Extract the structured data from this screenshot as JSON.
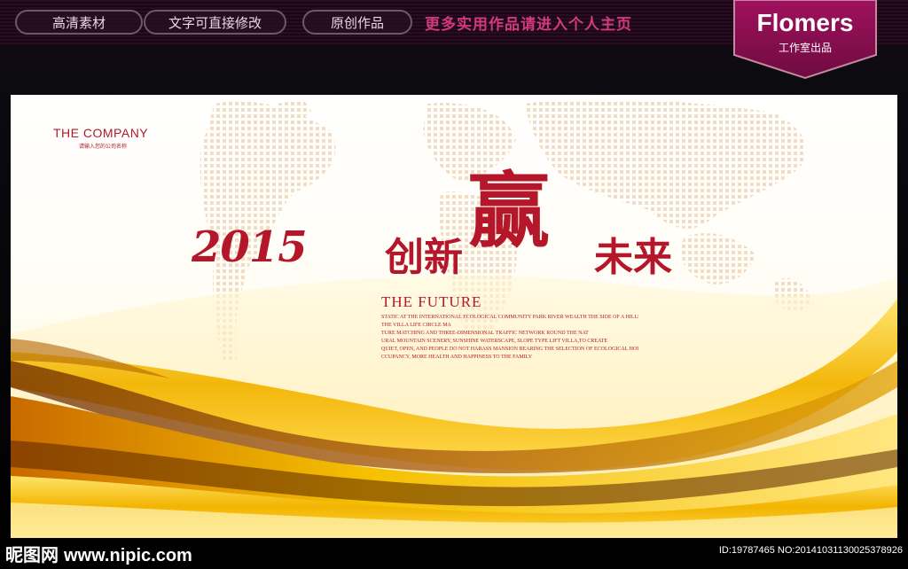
{
  "header": {
    "pills": [
      "高清素材",
      "文字可直接修改",
      "原创作品"
    ],
    "promo": "更多实用作品请进入个人主页",
    "brand": {
      "name": "Flomers",
      "sub": "工作室出品"
    }
  },
  "poster": {
    "company": "THE COMPANY",
    "company_sub": "请输入您的公司名称",
    "headline": {
      "year": "2015",
      "part_a": "创新",
      "win": "赢",
      "part_b": "未来"
    },
    "future_title": "THE FUTURE",
    "description": [
      "STATIC AT THE INTERNATIONAL ECOLOGICAL COMMUNITY PARK RIVER WEALTH THE SIDE OF A HILLENJOY",
      "THE VILLA LIFE CIRCLE MA",
      "TURE MATCHING AND THREE-DIMENSIONAL TRAFFIC NETWORK ROUND THE NAT",
      "URAL MOUNTAIN SCENERY, SUNSHINE WATERSCAPE, SLOPE TYPE LIFT VILLA,TO CREATE",
      "QUIET, OPEN, AND PEOPLE DO NOT HARASS MANSION BEARING THE SELECTION OF ECOLOGICAL HOUSE O",
      "CCUPANCY, MORE HEALTH AND HAPPINESS TO THE FAMILY"
    ]
  },
  "watermark": {
    "site_cn": "昵图网",
    "site_url": "www.nipic.com",
    "id_text": "ID:19787465 NO:20141031130025378926"
  },
  "colors": {
    "accent_red": "#b5172a",
    "promo_pink": "#d23a7e",
    "gold": "#f2c200"
  }
}
